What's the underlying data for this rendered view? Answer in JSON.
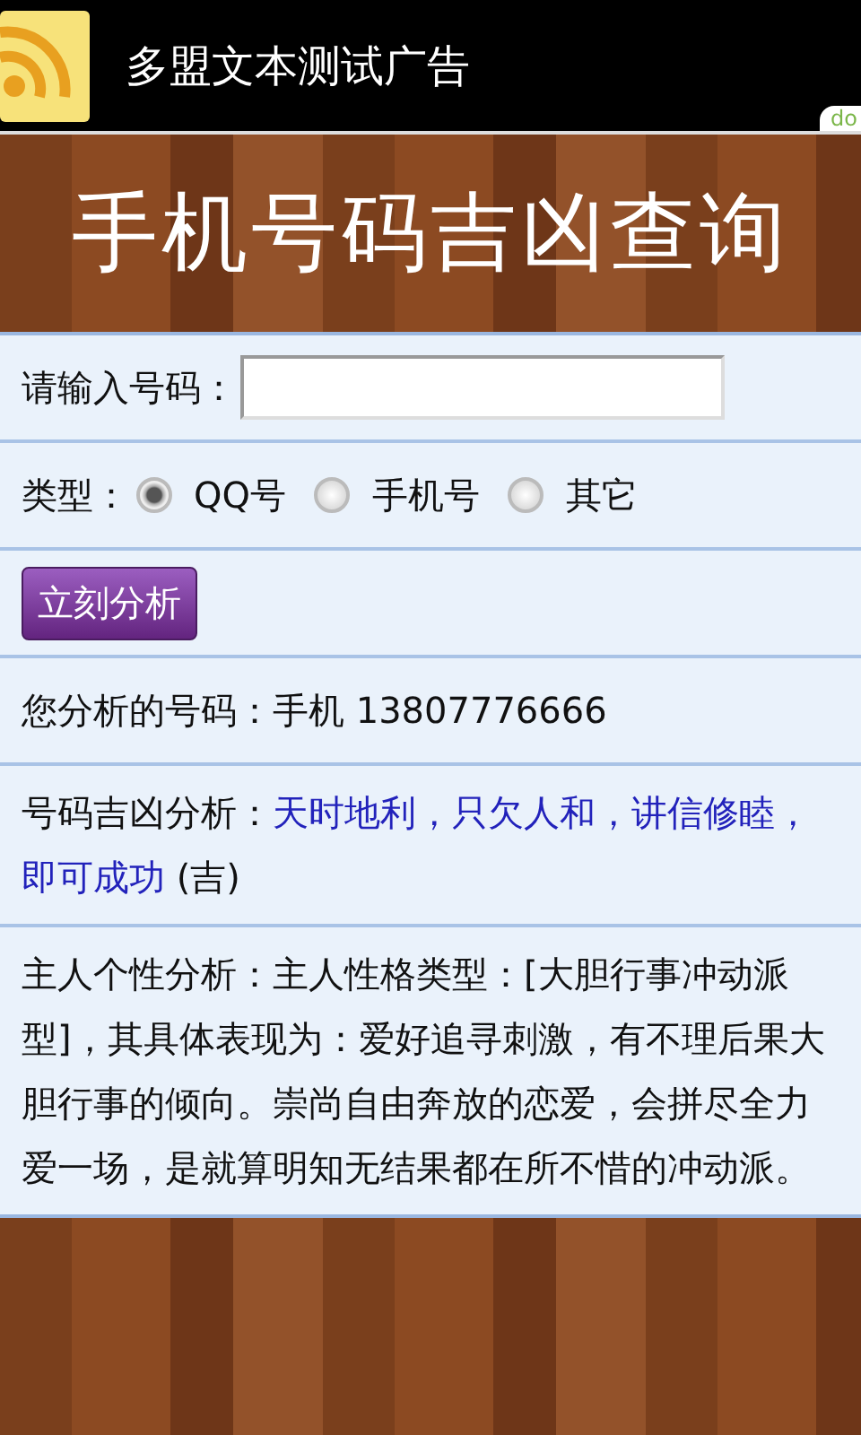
{
  "ad_bar": {
    "text": "多盟文本测试广告",
    "badge": "do"
  },
  "header": {
    "title": "手机号码吉凶查询"
  },
  "form": {
    "number_label": "请输入号码：",
    "type_label": "类型：",
    "types": [
      {
        "label": "QQ号",
        "selected": true
      },
      {
        "label": "手机号",
        "selected": false
      },
      {
        "label": "其它",
        "selected": false
      }
    ],
    "submit": "立刻分析"
  },
  "results": {
    "number": "您分析的号码：手机 13807776666",
    "luck_label": "号码吉凶分析：",
    "luck_verdict": "天时地利，只欠人和，讲信修睦，即可成功",
    "luck_rating": "(吉)",
    "personality": "主人个性分析：主人性格类型：[大胆行事冲动派型]，其具体表现为：爱好追寻刺激，有不理后果大胆行事的倾向。崇尚自由奔放的恋爱，会拼尽全力爱一场，是就算明知无结果都在所不惜的冲动派。"
  }
}
